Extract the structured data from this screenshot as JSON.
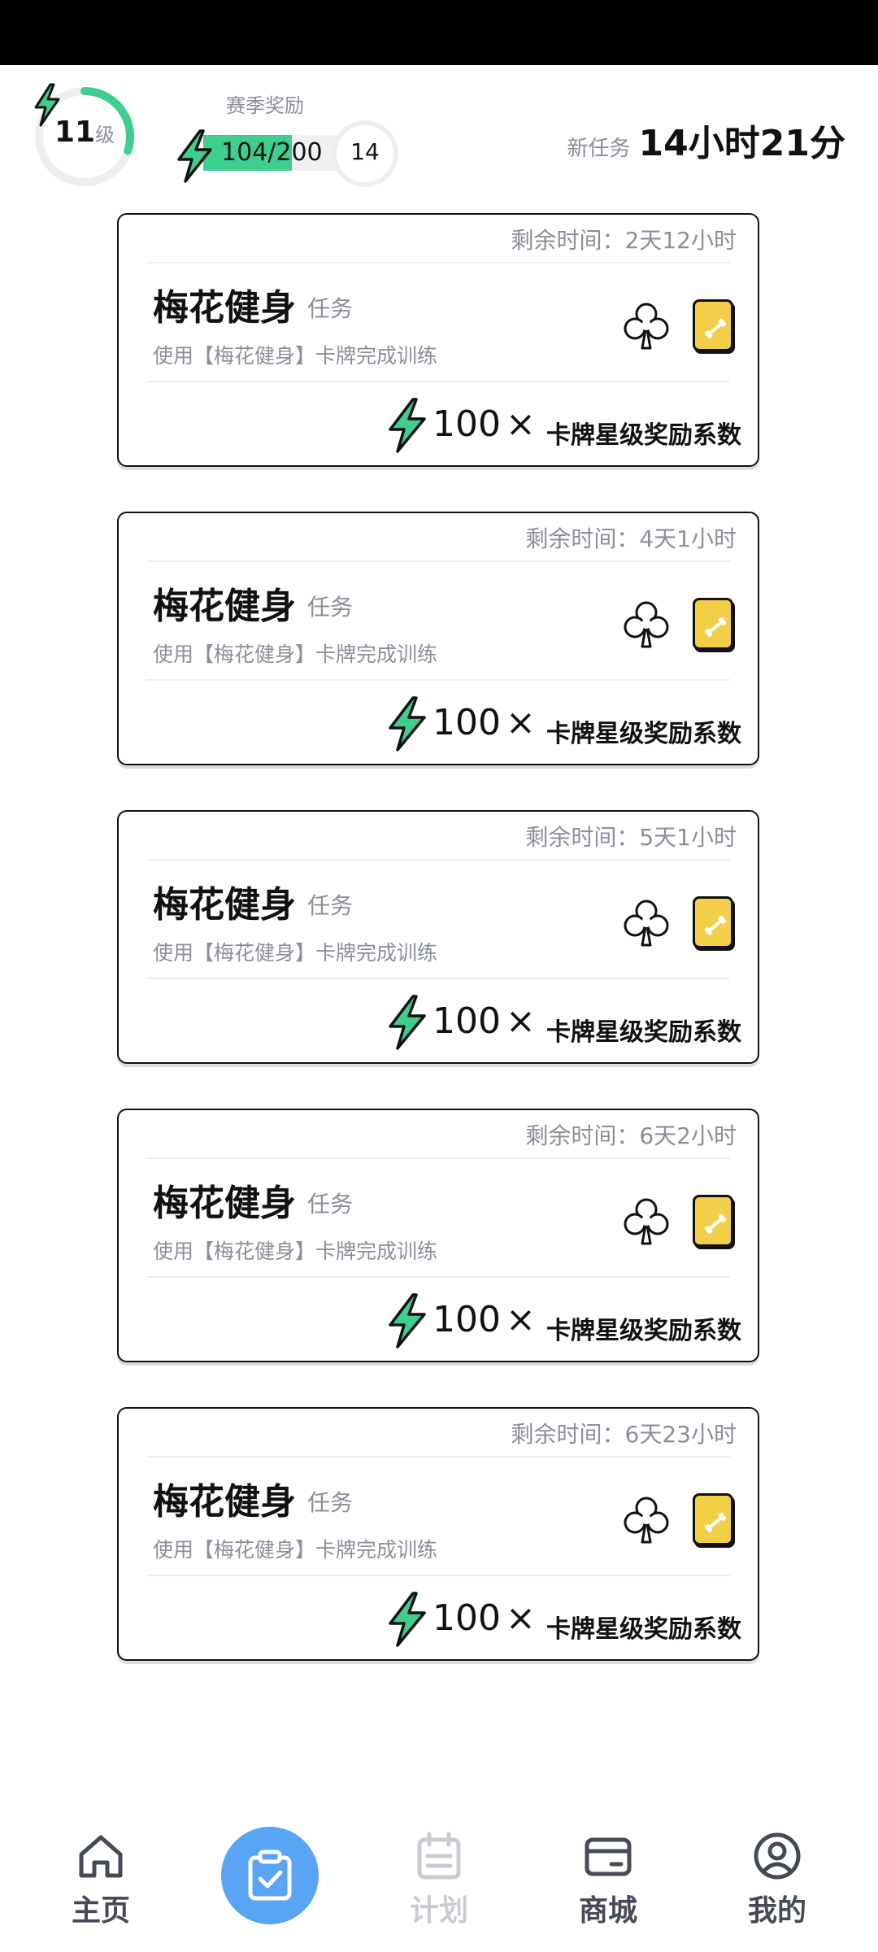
{
  "header": {
    "level_value": "11",
    "level_unit": "级",
    "level_progress": 0.3,
    "season_label": "赛季奖励",
    "season_progress_text": "104/200",
    "season_progress": 0.52,
    "season_next": "14",
    "new_task_label": "新任务",
    "new_task_time": "14小时21分"
  },
  "cards": [
    {
      "remaining": "剩余时间：2天12小时",
      "title": "梅花健身",
      "subtitle": "任务",
      "desc": "使用【梅花健身】卡牌完成训练",
      "reward_amount": "100",
      "reward_times": "×",
      "reward_label": "卡牌星级奖励系数"
    },
    {
      "remaining": "剩余时间：4天1小时",
      "title": "梅花健身",
      "subtitle": "任务",
      "desc": "使用【梅花健身】卡牌完成训练",
      "reward_amount": "100",
      "reward_times": "×",
      "reward_label": "卡牌星级奖励系数"
    },
    {
      "remaining": "剩余时间：5天1小时",
      "title": "梅花健身",
      "subtitle": "任务",
      "desc": "使用【梅花健身】卡牌完成训练",
      "reward_amount": "100",
      "reward_times": "×",
      "reward_label": "卡牌星级奖励系数"
    },
    {
      "remaining": "剩余时间：6天2小时",
      "title": "梅花健身",
      "subtitle": "任务",
      "desc": "使用【梅花健身】卡牌完成训练",
      "reward_amount": "100",
      "reward_times": "×",
      "reward_label": "卡牌星级奖励系数"
    },
    {
      "remaining": "剩余时间：6天23小时",
      "title": "梅花健身",
      "subtitle": "任务",
      "desc": "使用【梅花健身】卡牌完成训练",
      "reward_amount": "100",
      "reward_times": "×",
      "reward_label": "卡牌星级奖励系数"
    }
  ],
  "nav": {
    "home": "主页",
    "plan": "计划",
    "shop": "商城",
    "mine": "我的"
  },
  "colors": {
    "accent_green": "#3ecf8e",
    "nav_blue": "#5aa4f5",
    "card_yellow": "#f3cf49",
    "muted_text": "#8a8f98"
  },
  "icons": {
    "bolt": "lightning-bolt-icon",
    "club": "club-suit-icon",
    "home": "home-icon",
    "tasks": "clipboard-check-icon",
    "plan": "calendar-icon",
    "shop": "wallet-icon",
    "mine": "user-circle-icon"
  }
}
